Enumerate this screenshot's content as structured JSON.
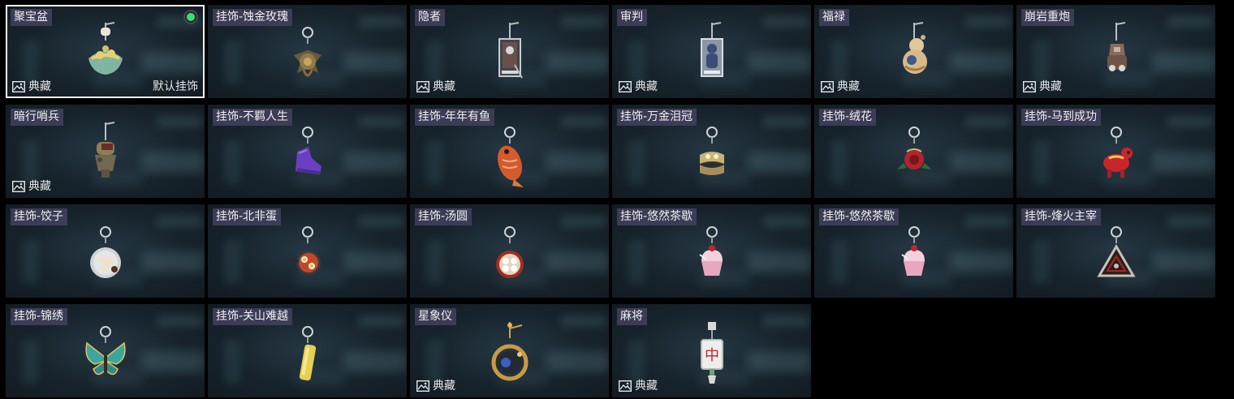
{
  "labels": {
    "collection": "典藏",
    "default": "默认挂饰"
  },
  "items": [
    {
      "name": "聚宝盆",
      "icon": "treasure-bowl-icon",
      "collection": true,
      "selected": true,
      "equipped": true,
      "default": true
    },
    {
      "name": "挂饰-蚀金玫瑰",
      "icon": "gold-rose-icon",
      "collection": false
    },
    {
      "name": "隐者",
      "icon": "hermit-card-icon",
      "collection": true
    },
    {
      "name": "审判",
      "icon": "judgement-card-icon",
      "collection": true
    },
    {
      "name": "福禄",
      "icon": "gourd-icon",
      "collection": true
    },
    {
      "name": "崩岩重炮",
      "icon": "rock-cannon-icon",
      "collection": true
    },
    {
      "name": "暗行哨兵",
      "icon": "sentinel-icon",
      "collection": true
    },
    {
      "name": "挂饰-不羁人生",
      "icon": "sneaker-icon",
      "collection": false
    },
    {
      "name": "挂饰-年年有鱼",
      "icon": "fish-icon",
      "collection": false
    },
    {
      "name": "挂饰-万金泪冠",
      "icon": "tear-crown-icon",
      "collection": false
    },
    {
      "name": "挂饰-绒花",
      "icon": "velvet-flower-icon",
      "collection": false
    },
    {
      "name": "挂饰-马到成功",
      "icon": "horse-icon",
      "collection": false
    },
    {
      "name": "挂饰-饺子",
      "icon": "dumpling-plate-icon",
      "collection": false
    },
    {
      "name": "挂饰-北非蛋",
      "icon": "shakshuka-pan-icon",
      "collection": false
    },
    {
      "name": "挂饰-汤圆",
      "icon": "tangyuan-bowl-icon",
      "collection": false
    },
    {
      "name": "挂饰-悠然茶歇",
      "icon": "cupcake-icon",
      "collection": false
    },
    {
      "name": "挂饰-悠然茶歇",
      "icon": "cupcake-icon",
      "collection": false
    },
    {
      "name": "挂饰-烽火主宰",
      "icon": "triangle-emblem-icon",
      "collection": false
    },
    {
      "name": "挂饰-锦绣",
      "icon": "butterfly-icon",
      "collection": false
    },
    {
      "name": "挂饰-关山难越",
      "icon": "yellow-stick-icon",
      "collection": false
    },
    {
      "name": "星象仪",
      "icon": "orrery-icon",
      "collection": true
    },
    {
      "name": "麻将",
      "icon": "mahjong-tile-icon",
      "collection": true
    }
  ]
}
